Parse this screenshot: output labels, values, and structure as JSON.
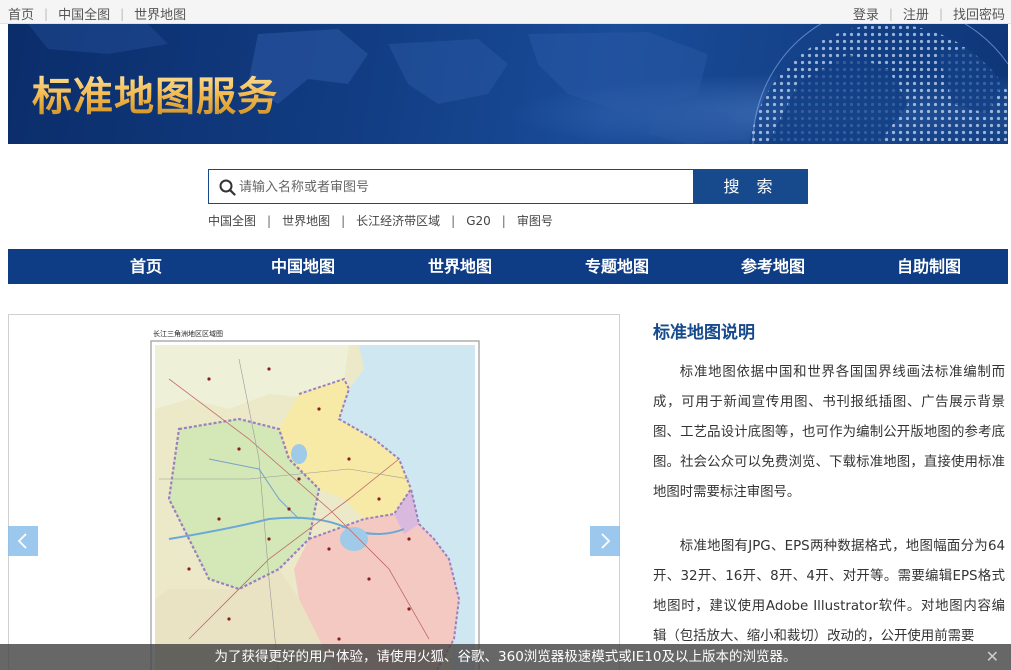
{
  "topbar": {
    "left_links": [
      "首页",
      "中国全图",
      "世界地图"
    ],
    "right_links": [
      "登录",
      "注册",
      "找回密码"
    ]
  },
  "banner": {
    "title": "标准地图服务"
  },
  "search": {
    "placeholder": "请输入名称或者审图号",
    "button_label": "搜 索",
    "quick_links": [
      "中国全图",
      "世界地图",
      "长江经济带区域",
      "G20",
      "审图号"
    ]
  },
  "nav": {
    "items": [
      "首页",
      "中国地图",
      "世界地图",
      "专题地图",
      "参考地图",
      "自助制图"
    ]
  },
  "viewer": {
    "map_caption": "长江三角洲地区区域图"
  },
  "description": {
    "title": "标准地图说明",
    "paragraph1": "标准地图依据中国和世界各国国界线画法标准编制而成，可用于新闻宣传用图、书刊报纸插图、广告展示背景图、工艺品设计底图等，也可作为编制公开版地图的参考底图。社会公众可以免费浏览、下载标准地图，直接使用标准地图时需要标注审图号。",
    "paragraph2": "标准地图有JPG、EPS两种数据格式，地图幅面分为64开、32开、16开、8开、4开、对开等。需要编辑EPS格式地图时，建议使用Adobe Illustrator软件。对地图内容编辑（包括放大、缩小和裁切）改动的，公开使用前需要"
  },
  "notice": {
    "text": "为了获得更好的用户体验，请使用火狐、谷歌、360浏览器极速模式或IE10及以上版本的浏览器。",
    "close": "✕"
  },
  "colors": {
    "primary": "#174a8c",
    "nav": "#0e3d85",
    "banner_title": "#f2b84c"
  }
}
